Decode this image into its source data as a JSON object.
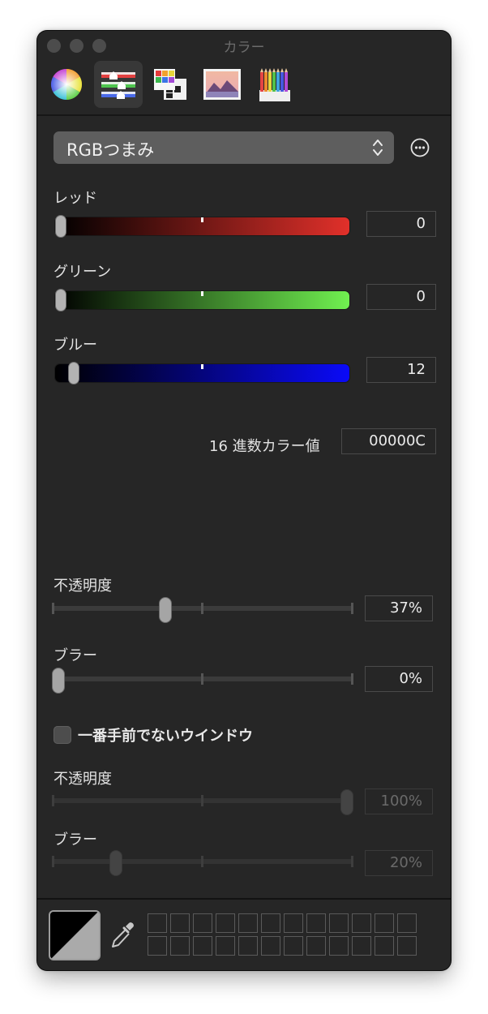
{
  "window": {
    "title": "カラー"
  },
  "toolbar": {
    "tabs": [
      {
        "icon": "color-wheel-icon",
        "selected": false
      },
      {
        "icon": "color-sliders-icon",
        "selected": true
      },
      {
        "icon": "color-palettes-icon",
        "selected": false
      },
      {
        "icon": "image-palettes-icon",
        "selected": false
      },
      {
        "icon": "pencils-icon",
        "selected": false
      }
    ]
  },
  "mode_popup": {
    "value": "RGBつまみ"
  },
  "sliders": {
    "red": {
      "label": "レッド",
      "value": "0",
      "fraction": 0.0,
      "color": "#e1302a"
    },
    "green": {
      "label": "グリーン",
      "value": "0",
      "fraction": 0.0,
      "color": "#70f050"
    },
    "blue": {
      "label": "ブルー",
      "value": "12",
      "fraction": 0.047,
      "color": "#0a0af8"
    }
  },
  "hex": {
    "label": "16 進数カラー値",
    "value": "00000C"
  },
  "active": {
    "opacity": {
      "label": "不透明度",
      "value": "37%",
      "fraction": 0.37
    },
    "blur": {
      "label": "ブラー",
      "value": "0%",
      "fraction": 0.0
    }
  },
  "inactive_checkbox": {
    "label": "一番手前でないウインドウ",
    "checked": false
  },
  "inactive": {
    "opacity": {
      "label": "不透明度",
      "value": "100%",
      "fraction": 1.0
    },
    "blur": {
      "label": "ブラー",
      "value": "20%",
      "fraction": 0.2
    }
  },
  "colors": {
    "background": "#262626",
    "accent_selected_tab": "#383838"
  }
}
